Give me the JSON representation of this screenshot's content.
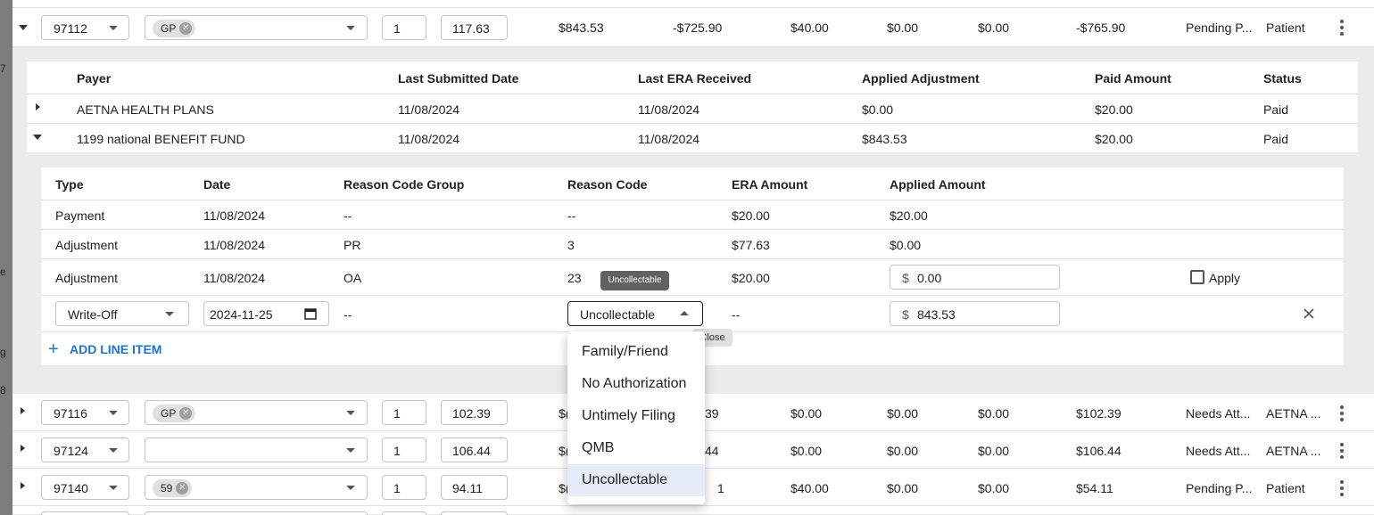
{
  "left_strip": [
    "7",
    "e",
    "g",
    "8"
  ],
  "top_row": {
    "code": "97112",
    "modifier_chip": "GP",
    "units": "1",
    "charge": "117.63",
    "cols": [
      "$843.53",
      "-$725.90",
      "$40.00",
      "$0.00",
      "$0.00",
      "-$765.90",
      "Pending P...",
      "Patient"
    ]
  },
  "payer_table": {
    "headers": [
      "Payer",
      "Last Submitted Date",
      "Last ERA Received",
      "Applied Adjustment",
      "Paid Amount",
      "Status"
    ],
    "rows": [
      [
        "AETNA HEALTH PLANS",
        "11/08/2024",
        "11/08/2024",
        "$0.00",
        "$20.00",
        "Paid"
      ],
      [
        "1199 national BENEFIT FUND",
        "11/08/2024",
        "11/08/2024",
        "$843.53",
        "$20.00",
        "Paid"
      ]
    ]
  },
  "line_items": {
    "headers": [
      "Type",
      "Date",
      "Reason Code Group",
      "Reason Code",
      "ERA Amount",
      "Applied Amount"
    ],
    "rows": [
      [
        "Payment",
        "11/08/2024",
        "--",
        "--",
        "$20.00",
        "$20.00"
      ],
      [
        "Adjustment",
        "11/08/2024",
        "PR",
        "3",
        "$77.63",
        "$0.00"
      ]
    ],
    "row3": {
      "type": "Adjustment",
      "date": "11/08/2024",
      "group": "OA",
      "code": "23",
      "era": "$20.00",
      "currency": "$",
      "applied": "0.00",
      "apply_label": "Apply"
    },
    "edit_row": {
      "type": "Write-Off",
      "date": "2024-11-25",
      "group": "--",
      "reason": "Uncollectable",
      "era": "--",
      "currency": "$",
      "applied": "843.53"
    },
    "add_label": "ADD LINE ITEM",
    "add_symbol": "+"
  },
  "tooltips": {
    "reason": "Uncollectable",
    "close": "Close"
  },
  "menu_options": [
    "Family/Friend",
    "No Authorization",
    "Untimely Filing",
    "QMB",
    "Uncollectable"
  ],
  "bottom_rows": [
    {
      "code": "97116",
      "chip": "GP",
      "units": "1",
      "charge": "102.39",
      "c1": "$(",
      "c2": "39",
      "cols": [
        "$0.00",
        "$0.00",
        "$0.00",
        "$102.39",
        "Needs Att...",
        "AETNA ..."
      ]
    },
    {
      "code": "97124",
      "chip": "",
      "units": "1",
      "charge": "106.44",
      "c1": "$(",
      "c2": "44",
      "cols": [
        "$0.00",
        "$0.00",
        "$0.00",
        "$106.44",
        "Needs Att...",
        "AETNA ..."
      ]
    },
    {
      "code": "97140",
      "chip": "59",
      "units": "1",
      "charge": "94.11",
      "c1": "$(",
      "c2": "1",
      "cols": [
        "$40.00",
        "$0.00",
        "$0.00",
        "$54.11",
        "Pending P...",
        "Patient"
      ]
    }
  ],
  "colors": {
    "accent": "#1976d2",
    "selected_bg": "#e3ecf8"
  }
}
